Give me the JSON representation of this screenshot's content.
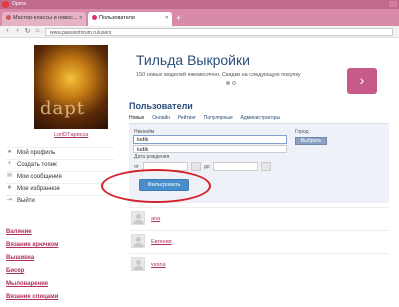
{
  "browser": {
    "app_name": "Opera",
    "tabs": [
      {
        "label": "Мастер-классы и новос..."
      },
      {
        "label": "Пользователи"
      }
    ],
    "new_tab": "+",
    "url": "www.passionforum.ru/users"
  },
  "sidebar": {
    "username": "LoriDTарисса",
    "avatar_watermark": "dapt",
    "menu": [
      {
        "label": "Мой профиль",
        "icon": "person-icon"
      },
      {
        "label": "Создать топик",
        "icon": "plus-icon"
      },
      {
        "label": "Мои сообщения",
        "icon": "envelope-icon"
      },
      {
        "label": "Мое избранное",
        "icon": "star-icon"
      },
      {
        "label": "Выйти",
        "icon": "exit-icon"
      }
    ],
    "categories": [
      {
        "label": "Валяние"
      },
      {
        "label": "Вязание крючком"
      },
      {
        "label": "Вышивка"
      },
      {
        "label": "Бисер"
      },
      {
        "label": "Мыловарение"
      },
      {
        "label": "Вязание спицами"
      }
    ]
  },
  "ad": {
    "title": "Тильда Выкройки",
    "subtitle": "150 новых моделей ежемесячно. Скидки на следующую покупку",
    "arrow": "›"
  },
  "main": {
    "title": "Пользователи",
    "subtabs": [
      {
        "label": "Новые",
        "active": true
      },
      {
        "label": "Онлайн",
        "active": false
      },
      {
        "label": "Рейтинг",
        "active": false
      },
      {
        "label": "Популярные",
        "active": false
      },
      {
        "label": "Администраторы",
        "active": false
      }
    ],
    "filter": {
      "nick_label": "Никнейм",
      "nick_value": "ludik",
      "suggestion": "ludik",
      "city_label": "Город",
      "choose_button": "Выбрать",
      "birth_label": "Дата рождения",
      "from_label": "от",
      "to_label": "до",
      "submit_button": "Фильтровать"
    },
    "users": [
      {
        "name": "ana"
      },
      {
        "name": "Евгения"
      },
      {
        "name": "vesna"
      }
    ]
  },
  "colors": {
    "titlebar": "#c06a8e",
    "accent_link": "#b03060",
    "heading": "#2a4e7a",
    "filter_button": "#4a8fcc",
    "highlight_ellipse": "#d4202a"
  }
}
